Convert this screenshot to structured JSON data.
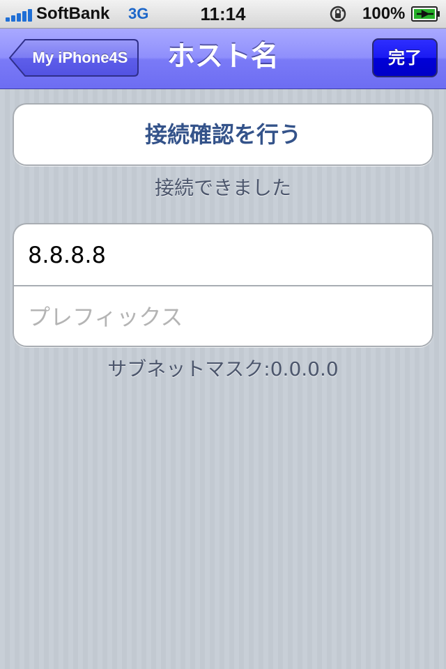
{
  "status_bar": {
    "carrier": "SoftBank",
    "network": "3G",
    "time": "11:14",
    "battery": "100%",
    "icons": [
      "signal-bars-icon",
      "rotation-lock-icon",
      "battery-charging-icon"
    ]
  },
  "nav": {
    "back_label": "My iPhone4S",
    "title": "ホスト名",
    "done_label": "完了",
    "colors": {
      "bar": "#8f8ffc",
      "done_button": "#1a1af2"
    }
  },
  "main": {
    "check_button_label": "接続確認を行う",
    "connection_status": "接続できました",
    "host_field": {
      "value": "8.8.8.8",
      "placeholder": ""
    },
    "prefix_field": {
      "value": "",
      "placeholder": "プレフィックス"
    },
    "subnet_mask": "サブネットマスク:0.0.0.0"
  }
}
